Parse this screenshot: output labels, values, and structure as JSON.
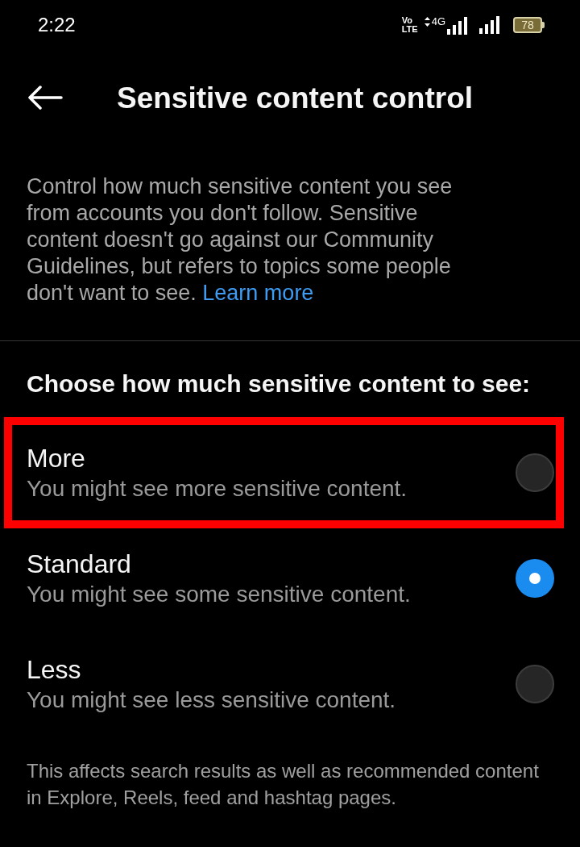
{
  "status_bar": {
    "time": "2:22",
    "volte": [
      "Vo",
      "LTE"
    ],
    "network": "4G",
    "battery": "78"
  },
  "header": {
    "title": "Sensitive content control"
  },
  "description": {
    "text": "Control how much sensitive content you see from accounts you don't follow. Sensitive content doesn't go against our Community Guidelines, but refers to topics some people don't want to see.",
    "link": "Learn more"
  },
  "section_heading": "Choose how much sensitive content to see:",
  "options": [
    {
      "label": "More",
      "description": "You might see more sensitive content.",
      "selected": false,
      "highlighted": true
    },
    {
      "label": "Standard",
      "description": "You might see some sensitive content.",
      "selected": true,
      "highlighted": false
    },
    {
      "label": "Less",
      "description": "You might see less sensitive content.",
      "selected": false,
      "highlighted": false
    }
  ],
  "footnote": "This affects search results as well as recommended content in Explore, Reels, feed and hashtag pages."
}
